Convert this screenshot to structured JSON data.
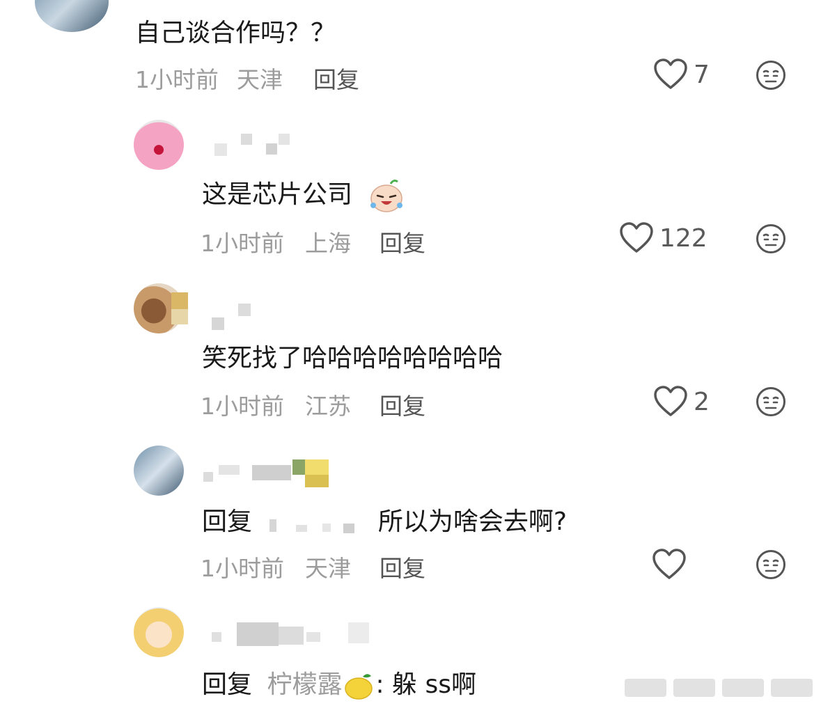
{
  "comments": [
    {
      "text": "自己谈合作吗？？",
      "time": "1小时前",
      "location": "天津",
      "reply_label": "回复",
      "likes": "7"
    },
    {
      "text": "这是芯片公司",
      "emoji": "crying-laughing-face",
      "time": "1小时前",
      "location": "上海",
      "reply_label": "回复",
      "likes": "122"
    },
    {
      "text": "笑死找了哈哈哈哈哈哈哈哈",
      "time": "1小时前",
      "location": "江苏",
      "reply_label": "回复",
      "likes": "2"
    },
    {
      "reply_prefix": "回复",
      "text": "所以为啥会去啊?",
      "time": "1小时前",
      "location": "天津",
      "reply_label": "回复",
      "likes": ""
    },
    {
      "reply_prefix": "回复",
      "reply_to": "柠檬露",
      "emoji": "lemon",
      "text": ": 躲 ss啊"
    }
  ],
  "colors": {
    "meta": "#9c9c9c",
    "icon": "#555555",
    "text": "#1a1a1a"
  }
}
